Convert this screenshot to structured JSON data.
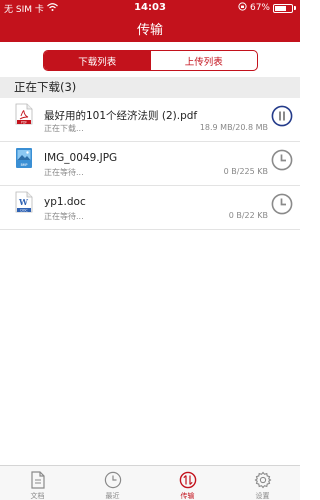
{
  "status_bar": {
    "carrier": "无 SIM 卡",
    "time": "14:03",
    "battery": "67%",
    "battery_level": 0.67,
    "icons": [
      "wifi-icon",
      "orientation-lock-icon",
      "battery-icon"
    ]
  },
  "header": {
    "title": "传输"
  },
  "segments": {
    "download_label": "下载列表",
    "upload_label": "上传列表",
    "active": "download"
  },
  "section": {
    "title": "正在下载(3)"
  },
  "downloads": [
    {
      "name": "最好用的101个经济法则 (2).pdf",
      "status": "正在下载...",
      "size": "18.9 MB/20.8 MB",
      "type": "pdf",
      "type_label": "PDF",
      "action": "pause"
    },
    {
      "name": "IMG_0049.JPG",
      "status": "正在等待...",
      "size": "0 B/225 KB",
      "type": "image",
      "type_label": "BMP",
      "action": "waiting"
    },
    {
      "name": "yp1.doc",
      "status": "正在等待...",
      "size": "0 B/22 KB",
      "type": "doc",
      "type_label": "DOC",
      "action": "waiting"
    }
  ],
  "tabbar": {
    "tabs": [
      {
        "label": "文档",
        "icon": "document-icon"
      },
      {
        "label": "最近",
        "icon": "clock-icon"
      },
      {
        "label": "传输",
        "icon": "transfer-icon",
        "active": true
      },
      {
        "label": "设置",
        "icon": "gear-icon"
      }
    ]
  },
  "colors": {
    "brand": "#c3121c",
    "pause_ring": "#243b8a",
    "muted": "#888888"
  }
}
